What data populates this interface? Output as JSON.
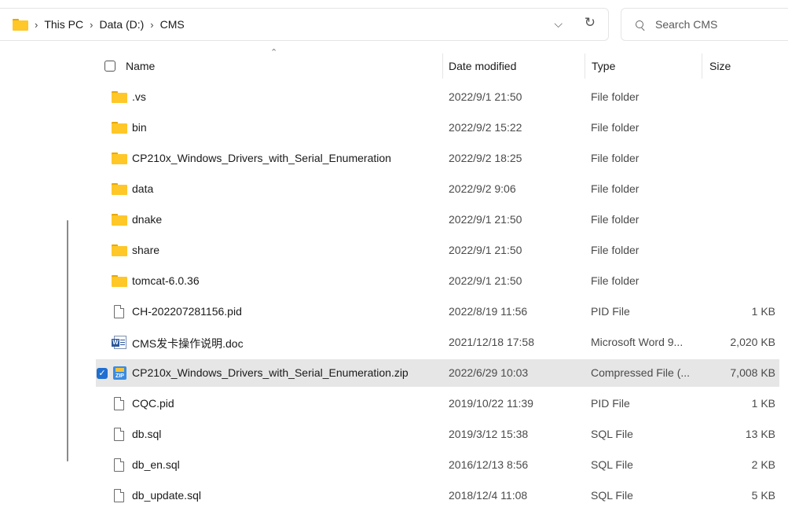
{
  "address_bar": {
    "breadcrumbs": [
      "This PC",
      "Data (D:)",
      "CMS"
    ],
    "separator": "›",
    "dropdown_icon": "chevron-down-icon",
    "refresh_icon": "refresh-icon"
  },
  "search": {
    "placeholder": "Search CMS"
  },
  "columns": {
    "name": "Name",
    "date": "Date modified",
    "type": "Type",
    "size": "Size"
  },
  "files": [
    {
      "name": ".vs",
      "date": "2022/9/1 21:50",
      "type": "File folder",
      "size": "",
      "icon": "folder-icon"
    },
    {
      "name": "bin",
      "date": "2022/9/2 15:22",
      "type": "File folder",
      "size": "",
      "icon": "folder-icon"
    },
    {
      "name": "CP210x_Windows_Drivers_with_Serial_Enumeration",
      "date": "2022/9/2 18:25",
      "type": "File folder",
      "size": "",
      "icon": "folder-icon"
    },
    {
      "name": "data",
      "date": "2022/9/2 9:06",
      "type": "File folder",
      "size": "",
      "icon": "folder-icon"
    },
    {
      "name": "dnake",
      "date": "2022/9/1 21:50",
      "type": "File folder",
      "size": "",
      "icon": "folder-icon"
    },
    {
      "name": "share",
      "date": "2022/9/1 21:50",
      "type": "File folder",
      "size": "",
      "icon": "folder-icon"
    },
    {
      "name": "tomcat-6.0.36",
      "date": "2022/9/1 21:50",
      "type": "File folder",
      "size": "",
      "icon": "folder-icon"
    },
    {
      "name": "CH-202207281156.pid",
      "date": "2022/8/19 11:56",
      "type": "PID File",
      "size": "1 KB",
      "icon": "file-icon"
    },
    {
      "name": "CMS发卡操作说明.doc",
      "date": "2021/12/18 17:58",
      "type": "Microsoft Word 9...",
      "size": "2,020 KB",
      "icon": "word-doc-icon"
    },
    {
      "name": "CP210x_Windows_Drivers_with_Serial_Enumeration.zip",
      "date": "2022/6/29 10:03",
      "type": "Compressed File (...",
      "size": "7,008 KB",
      "icon": "zip-icon",
      "selected": true
    },
    {
      "name": "CQC.pid",
      "date": "2019/10/22 11:39",
      "type": "PID File",
      "size": "1 KB",
      "icon": "file-icon"
    },
    {
      "name": "db.sql",
      "date": "2019/3/12 15:38",
      "type": "SQL File",
      "size": "13 KB",
      "icon": "file-icon"
    },
    {
      "name": "db_en.sql",
      "date": "2016/12/13 8:56",
      "type": "SQL File",
      "size": "2 KB",
      "icon": "file-icon"
    },
    {
      "name": "db_update.sql",
      "date": "2018/12/4 11:08",
      "type": "SQL File",
      "size": "5 KB",
      "icon": "file-icon"
    }
  ],
  "colors": {
    "folder": "#ffc728",
    "selection": "#e6e6e6",
    "checkbox": "#1f6fd1"
  }
}
